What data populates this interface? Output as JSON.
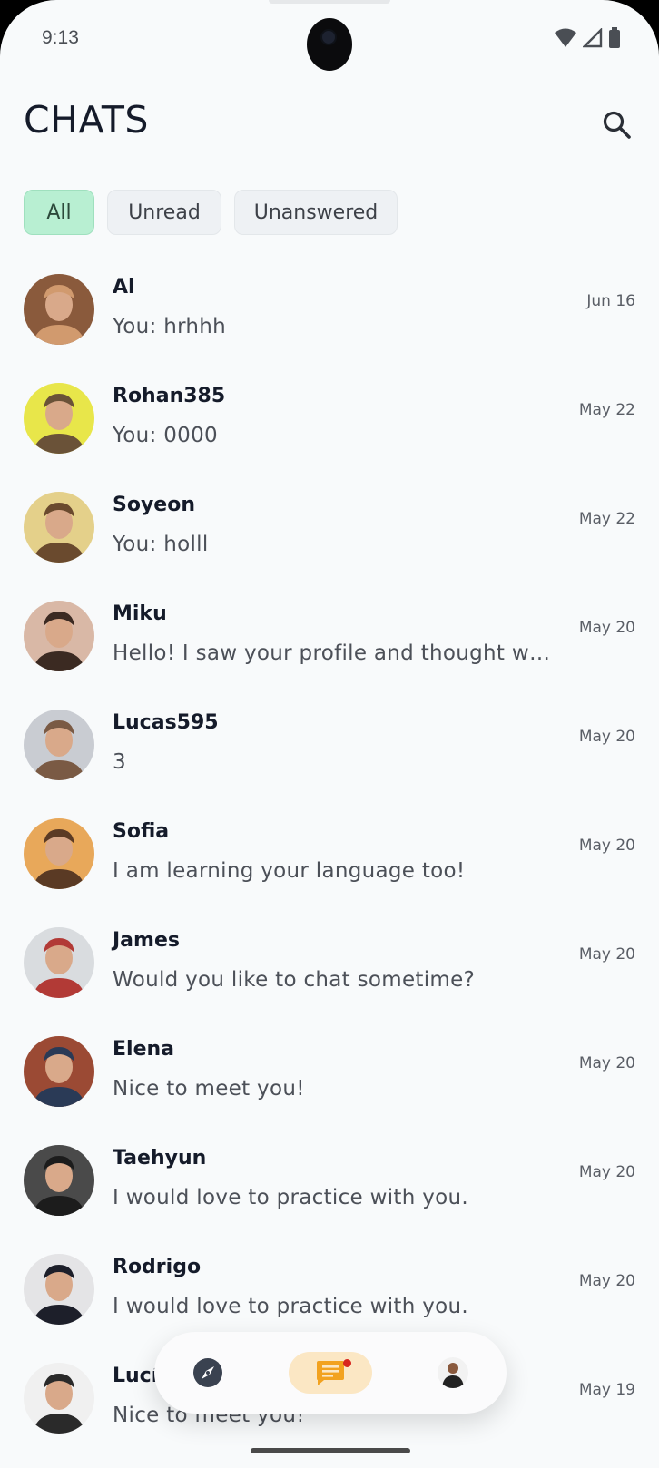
{
  "status_bar": {
    "time": "9:13"
  },
  "header": {
    "title": "CHATS"
  },
  "filters": [
    {
      "label": "All",
      "active": true
    },
    {
      "label": "Unread",
      "active": false
    },
    {
      "label": "Unanswered",
      "active": false
    }
  ],
  "chats": [
    {
      "name": "Al",
      "preview": "You: hrhhh",
      "date": "Jun 16",
      "avatar_colors": [
        "#8a5a3c",
        "#d19a6e"
      ]
    },
    {
      "name": "Rohan385",
      "preview": "You: 0000",
      "date": "May 22",
      "avatar_colors": [
        "#e8e64a",
        "#6a5238"
      ]
    },
    {
      "name": "Soyeon",
      "preview": "You: holll",
      "date": "May 22",
      "avatar_colors": [
        "#e4d08a",
        "#6a4a2e"
      ]
    },
    {
      "name": "Miku",
      "preview": "Hello! I saw your profile and thought we c...",
      "date": "May 20",
      "avatar_colors": [
        "#d9b8a6",
        "#3b2a22"
      ]
    },
    {
      "name": "Lucas595",
      "preview": "3",
      "date": "May 20",
      "avatar_colors": [
        "#c9ccd2",
        "#7a5a44"
      ]
    },
    {
      "name": "Sofia",
      "preview": "I am learning your language too!",
      "date": "May 20",
      "avatar_colors": [
        "#e8a85a",
        "#5a3a24"
      ]
    },
    {
      "name": "James",
      "preview": "Would you like to chat sometime?",
      "date": "May 20",
      "avatar_colors": [
        "#d9dcdf",
        "#b23a36"
      ]
    },
    {
      "name": "Elena",
      "preview": "Nice to meet you!",
      "date": "May 20",
      "avatar_colors": [
        "#9b4a34",
        "#2a3a56"
      ]
    },
    {
      "name": "Taehyun",
      "preview": "I would love to practice with you.",
      "date": "May 20",
      "avatar_colors": [
        "#4a4a4a",
        "#1c1c1c"
      ]
    },
    {
      "name": "Rodrigo",
      "preview": "I would love to practice with you.",
      "date": "May 20",
      "avatar_colors": [
        "#e4e4e6",
        "#1d1f2a"
      ]
    },
    {
      "name": "Lucía",
      "preview": "Nice to meet you!",
      "date": "May 19",
      "avatar_colors": [
        "#f0f0f0",
        "#2a2a2a"
      ]
    }
  ],
  "bottom_nav": {
    "items": [
      {
        "icon": "compass-icon"
      },
      {
        "icon": "chat-bubble-icon",
        "active": true,
        "badge": true
      },
      {
        "icon": "profile-avatar"
      }
    ],
    "accent_color": "#f2a21f"
  }
}
